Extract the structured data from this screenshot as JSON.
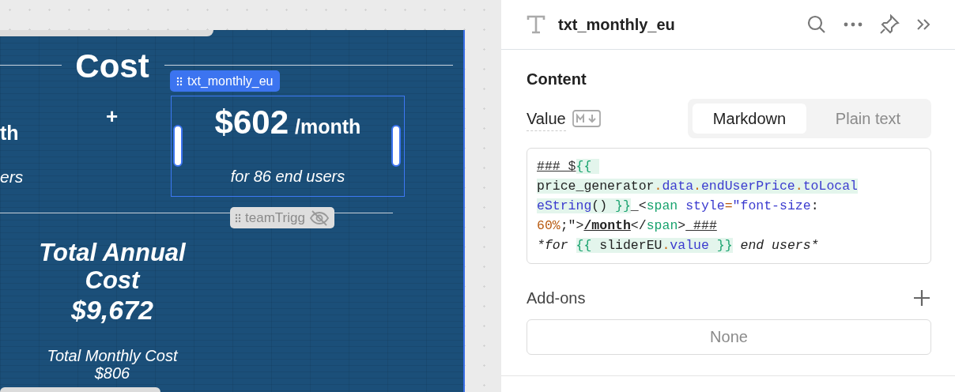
{
  "canvas": {
    "section_title": "Cost",
    "left_cell": {
      "title": "th",
      "subtitle": "ers"
    },
    "operator": "+",
    "selected_component": {
      "label": "txt_monthly_eu",
      "price": "$602",
      "unit": "/month",
      "caption": "for 86 end users"
    },
    "hidden_component": {
      "label": "teamTrigg",
      "hidden": true
    },
    "total_annual": {
      "label": "Total Annual Cost",
      "value": "$9,672"
    },
    "total_monthly": {
      "label": "Total Monthly Cost",
      "value": "$806"
    }
  },
  "inspector": {
    "title": "txt_monthly_eu",
    "section": "Content",
    "value_label": "Value",
    "modes": [
      {
        "label": "Markdown",
        "selected": true
      },
      {
        "label": "Plain text",
        "selected": false
      }
    ],
    "code_lines": [
      [
        {
          "text": "### $",
          "kind": "heading"
        },
        {
          "text": "{{ ",
          "kind": "brace"
        }
      ],
      [
        {
          "text": "price_generator",
          "kind": "ident"
        },
        {
          "text": ".",
          "kind": "dot"
        },
        {
          "text": "data",
          "kind": "prop"
        },
        {
          "text": ".",
          "kind": "dot"
        },
        {
          "text": "endUserPrice",
          "kind": "prop"
        },
        {
          "text": ".",
          "kind": "dot"
        },
        {
          "text": "toLocal",
          "kind": "prop"
        }
      ],
      [
        {
          "text": "eString",
          "kind": "prop"
        },
        {
          "text": "() ",
          "kind": "ident"
        },
        {
          "text": "}}",
          "kind": "brace"
        },
        {
          "text": "_<",
          "kind": "plain"
        },
        {
          "text": "span",
          "kind": "tag"
        },
        {
          "text": " style",
          "kind": "attr"
        },
        {
          "text": "=",
          "kind": "punct"
        },
        {
          "text": "\"font-size",
          "kind": "string"
        },
        {
          "text": ":",
          "kind": "plain"
        }
      ],
      [
        {
          "text": "60%",
          "kind": "num"
        },
        {
          "text": ";\">",
          "kind": "plain"
        },
        {
          "text": "/month",
          "kind": "strong"
        },
        {
          "text": "</",
          "kind": "plain"
        },
        {
          "text": "span",
          "kind": "tag"
        },
        {
          "text": ">",
          "kind": "plain"
        },
        {
          "text": " ###",
          "kind": "heading"
        }
      ],
      [
        {
          "text": "*for ",
          "kind": "em"
        },
        {
          "text": "{{ ",
          "kind": "brace"
        },
        {
          "text": "sliderEU",
          "kind": "ident"
        },
        {
          "text": ".",
          "kind": "dot"
        },
        {
          "text": "value",
          "kind": "prop"
        },
        {
          "text": " }}",
          "kind": "brace"
        },
        {
          "text": " end users*",
          "kind": "em"
        }
      ]
    ],
    "addons_label": "Add-ons",
    "addons_value": "None"
  }
}
